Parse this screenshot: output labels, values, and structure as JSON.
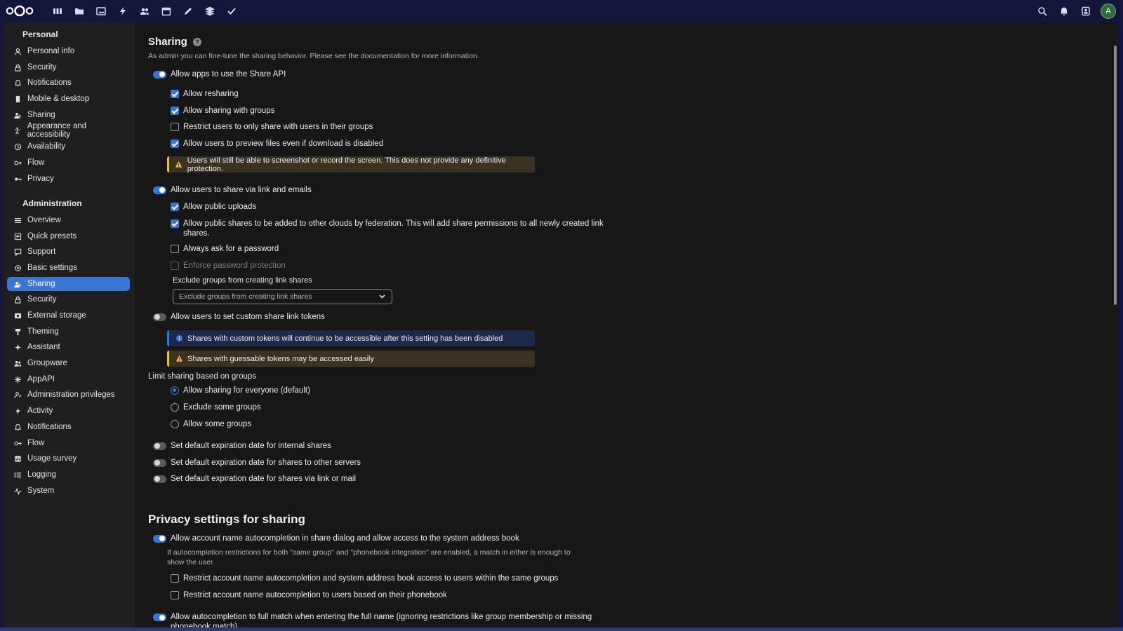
{
  "topbar": {
    "apps": [
      "dashboard-icon",
      "files-icon",
      "photos-icon",
      "activity-icon",
      "contacts-icon",
      "calendar-icon",
      "notes-icon",
      "deck-icon",
      "tasks-icon"
    ],
    "right": [
      "search-icon",
      "notifications-icon",
      "contacts-menu-icon"
    ],
    "avatar_initial": "A"
  },
  "sidebar": {
    "personal_title": "Personal",
    "personal": [
      {
        "label": "Personal info",
        "icon": "user-icon"
      },
      {
        "label": "Security",
        "icon": "lock-icon"
      },
      {
        "label": "Notifications",
        "icon": "bell-icon"
      },
      {
        "label": "Mobile & desktop",
        "icon": "phone-icon"
      },
      {
        "label": "Sharing",
        "icon": "share-icon"
      },
      {
        "label": "Appearance and accessibility",
        "icon": "accessibility-icon"
      },
      {
        "label": "Availability",
        "icon": "clock-icon"
      },
      {
        "label": "Flow",
        "icon": "flow-icon"
      },
      {
        "label": "Privacy",
        "icon": "key-icon"
      }
    ],
    "admin_title": "Administration",
    "admin": [
      {
        "label": "Overview",
        "icon": "list-icon"
      },
      {
        "label": "Quick presets",
        "icon": "presets-icon"
      },
      {
        "label": "Support",
        "icon": "support-icon"
      },
      {
        "label": "Basic settings",
        "icon": "gear-icon"
      },
      {
        "label": "Sharing",
        "icon": "share-icon",
        "active": true
      },
      {
        "label": "Security",
        "icon": "lock-icon"
      },
      {
        "label": "External storage",
        "icon": "storage-icon"
      },
      {
        "label": "Theming",
        "icon": "brush-icon"
      },
      {
        "label": "Assistant",
        "icon": "sparkle-icon"
      },
      {
        "label": "Groupware",
        "icon": "group-icon"
      },
      {
        "label": "AppAPI",
        "icon": "appapi-icon"
      },
      {
        "label": "Administration privileges",
        "icon": "admin-user-icon"
      },
      {
        "label": "Activity",
        "icon": "activity-icon"
      },
      {
        "label": "Notifications",
        "icon": "bell-icon"
      },
      {
        "label": "Flow",
        "icon": "flow-icon"
      },
      {
        "label": "Usage survey",
        "icon": "survey-icon"
      },
      {
        "label": "Logging",
        "icon": "logging-icon"
      },
      {
        "label": "System",
        "icon": "pulse-icon"
      }
    ]
  },
  "sharing": {
    "title": "Sharing",
    "description": "As admin you can fine-tune the sharing behavior. Please see the documentation for more information.",
    "share_api": "Allow apps to use the Share API",
    "allow_resharing": "Allow resharing",
    "allow_groups": "Allow sharing with groups",
    "restrict_groups": "Restrict users to only share with users in their groups",
    "allow_preview": "Allow users to preview files even if download is disabled",
    "preview_warning": "Users will still be able to screenshot or record the screen. This does not provide any definitive protection.",
    "share_link": "Allow users to share via link and emails",
    "public_uploads": "Allow public uploads",
    "federation_line1": "Allow public shares to be added to other clouds by federation. This will add share permissions to all newly created link",
    "federation_line2": "shares.",
    "ask_password": "Always ask for a password",
    "enforce_password": "Enforce password protection",
    "exclude_label": "Exclude groups from creating link shares",
    "exclude_placeholder": "Exclude groups from creating link shares",
    "custom_tokens": "Allow users to set custom share link tokens",
    "tokens_info": "Shares with custom tokens will continue to be accessible after this setting has been disabled",
    "tokens_warning": "Shares with guessable tokens may be accessed easily",
    "limit_title": "Limit sharing based on groups",
    "radio_everyone": "Allow sharing for everyone (default)",
    "radio_exclude": "Exclude some groups",
    "radio_allow": "Allow some groups",
    "exp_internal": "Set default expiration date for internal shares",
    "exp_servers": "Set default expiration date for shares to other servers",
    "exp_link": "Set default expiration date for shares via link or mail"
  },
  "privacy": {
    "title": "Privacy settings for sharing",
    "autocomplete": "Allow account name autocompletion in share dialog and allow access to the system address book",
    "autocomplete_desc_line1": "If autocompletion restrictions for both \"same group\" and \"phonebook integration\" are enabled, a match in either is enough to",
    "autocomplete_desc_line2": "show the user.",
    "restrict_same_group": "Restrict account name autocompletion and system address book access to users within the same groups",
    "restrict_phonebook": "Restrict account name autocompletion to users based on their phonebook",
    "full_match_line1": "Allow autocompletion to full match when entering the full name (ignoring restrictions like group membership or missing",
    "full_match_line2": "phonebook match)"
  },
  "colors": {
    "accent": "#3a75d4",
    "warning": "#e9c23a",
    "background": "#171717",
    "sidebar": "#1f1f22"
  }
}
